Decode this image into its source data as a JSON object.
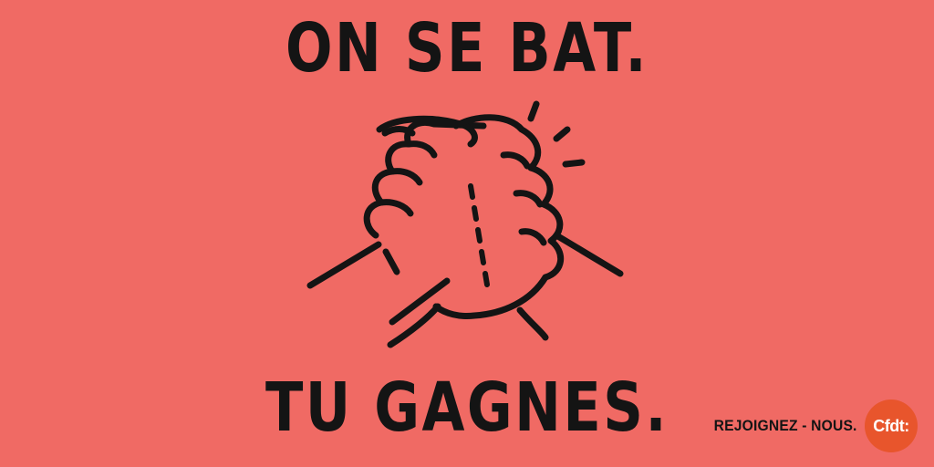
{
  "headline": {
    "top": "ON SE BAT.",
    "bottom": "TU GAGNES."
  },
  "footer": {
    "tagline": "REJOIGNEZ - NOUS.",
    "logo_text": "Cfdt:"
  },
  "colors": {
    "background": "#f06a64",
    "ink": "#141414",
    "logo_bg": "#e8552c",
    "logo_text": "#ffffff"
  },
  "icons": {
    "illustration": "handshake-clasp-icon"
  }
}
